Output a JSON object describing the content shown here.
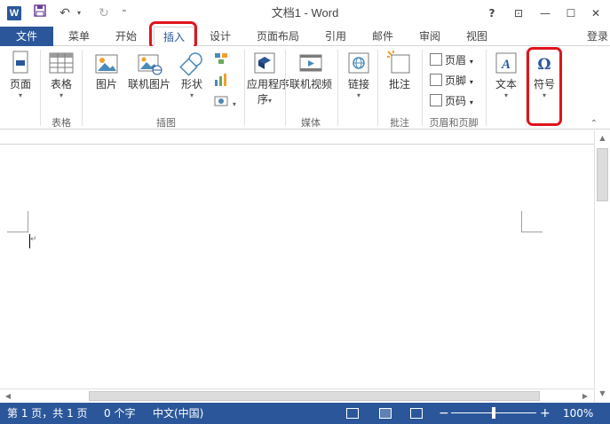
{
  "titlebar": {
    "app_icon": "W",
    "title": "文档1 - Word",
    "quick_access": {
      "save_icon": "save-icon",
      "undo": "↶",
      "redo": "↻",
      "customize": "⁼"
    },
    "window_controls": {
      "help": "?",
      "restore_ribbon": "⊡",
      "minimize": "—",
      "maximize": "☐",
      "close": "✕"
    }
  },
  "tabs": {
    "file": "文件",
    "items": [
      "菜单",
      "开始",
      "插入",
      "设计",
      "页面布局",
      "引用",
      "邮件",
      "审阅",
      "视图"
    ],
    "active": "插入",
    "login": "登录"
  },
  "ribbon": {
    "groups": [
      {
        "name": "",
        "buttons": [
          {
            "label": "页面",
            "icon": "page-icon"
          }
        ]
      },
      {
        "name": "表格",
        "buttons": [
          {
            "label": "表格",
            "icon": "table-icon"
          }
        ]
      },
      {
        "name": "插图",
        "buttons": [
          {
            "label": "图片",
            "icon": "picture-icon"
          },
          {
            "label": "联机图片",
            "icon": "online-picture-icon"
          },
          {
            "label": "形状",
            "icon": "shapes-icon"
          }
        ]
      },
      {
        "name": "",
        "buttons": [
          {
            "label": "应用程序",
            "label2": "序",
            "icon": "apps-icon"
          }
        ]
      },
      {
        "name": "媒体",
        "buttons": [
          {
            "label": "联机视频",
            "icon": "online-video-icon"
          }
        ]
      },
      {
        "name": "",
        "buttons": [
          {
            "label": "链接",
            "icon": "link-icon"
          }
        ]
      },
      {
        "name": "批注",
        "buttons": [
          {
            "label": "批注",
            "icon": "comment-icon"
          }
        ]
      },
      {
        "name": "页眉和页脚",
        "buttons": [
          {
            "label": "页眉",
            "icon": "header-icon"
          },
          {
            "label": "页脚",
            "icon": "footer-icon"
          },
          {
            "label": "页码",
            "icon": "page-number-icon"
          }
        ]
      },
      {
        "name": "",
        "buttons": [
          {
            "label": "文本",
            "icon": "text-icon"
          }
        ]
      },
      {
        "name": "",
        "buttons": [
          {
            "label": "符号",
            "icon": "omega-icon"
          }
        ]
      }
    ]
  },
  "status_bar": {
    "page": "第 1 页，共 1 页",
    "words": "0 个字",
    "language": "中文(中国)",
    "zoom": "100%",
    "zoom_minus": "−",
    "zoom_plus": "+"
  },
  "colors": {
    "accent": "#2b579a",
    "highlight": "#e0141d"
  }
}
